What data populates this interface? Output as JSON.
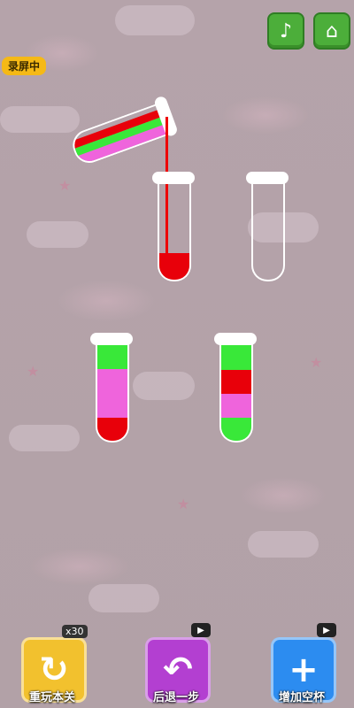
{
  "top_bar": {
    "music_icon": "♪",
    "home_icon": "⌂",
    "recording_label": "录屏中"
  },
  "colors": {
    "red": "#e8000a",
    "green": "#39e839",
    "pink": "#ef64dc",
    "music_btn": "#4cae3a",
    "restart_btn": "#f2c12e",
    "undo_btn": "#b33fd1",
    "add_tube_btn": "#2c8cf0"
  },
  "tubes": {
    "pouring": [
      "pink",
      "green",
      "red"
    ],
    "tube_top_left": [
      "red"
    ],
    "tube_top_right": [],
    "tube_bottom_left": [
      "green",
      "pink",
      "pink",
      "red"
    ],
    "tube_bottom_right": [
      "green",
      "red",
      "pink",
      "green"
    ]
  },
  "bottom_bar": {
    "restart": {
      "label": "重玩本关",
      "count": "x30",
      "icon": "↻"
    },
    "undo": {
      "label": "后退一步",
      "icon": "↶"
    },
    "add_tube": {
      "label": "增加空杯",
      "icon": "+"
    }
  }
}
